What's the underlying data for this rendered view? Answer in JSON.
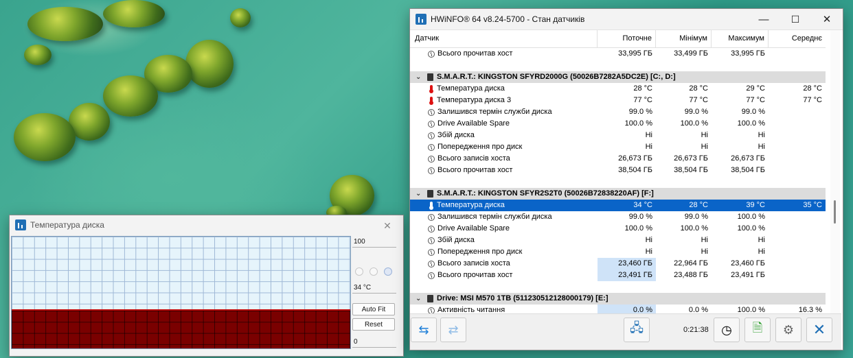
{
  "graph_window": {
    "title": "Температура диска",
    "max_value": "100",
    "current_value": "34 °C",
    "min_value": "0",
    "auto_fit_label": "Auto Fit",
    "reset_label": "Reset",
    "fill_level": 0.34,
    "close_icon": "close-icon"
  },
  "main_window": {
    "title": "HWiNFO® 64 v8.24-5700 - Стан датчиків",
    "columns": [
      "Датчик",
      "Поточне",
      "Мінімум",
      "Максимум",
      "Середнє"
    ],
    "rows": [
      {
        "type": "item",
        "icon": "clock-icon",
        "name": "Всього прочитав хост",
        "cur": "33,995 ГБ",
        "min": "33,499 ГБ",
        "max": "33,995 ГБ",
        "avg": ""
      },
      {
        "type": "spacer"
      },
      {
        "type": "group",
        "name": "S.M.A.R.T.: KINGSTON SFYRD2000G (50026B7282A5DC2E) [C:, D:]"
      },
      {
        "type": "item",
        "icon": "thermometer-icon",
        "name": "Температура диска",
        "cur": "28 °C",
        "min": "28 °C",
        "max": "29 °C",
        "avg": "28 °C"
      },
      {
        "type": "item",
        "icon": "thermometer-icon",
        "name": "Температура диска 3",
        "cur": "77 °C",
        "min": "77 °C",
        "max": "77 °C",
        "avg": "77 °C"
      },
      {
        "type": "item",
        "icon": "clock-icon",
        "name": "Залишився термін служби диска",
        "cur": "99.0 %",
        "min": "99.0 %",
        "max": "99.0 %",
        "avg": ""
      },
      {
        "type": "item",
        "icon": "clock-icon",
        "name": "Drive Available Spare",
        "cur": "100.0 %",
        "min": "100.0 %",
        "max": "100.0 %",
        "avg": ""
      },
      {
        "type": "item",
        "icon": "clock-icon",
        "name": "Збій диска",
        "cur": "Ні",
        "min": "Ні",
        "max": "Ні",
        "avg": ""
      },
      {
        "type": "item",
        "icon": "clock-icon",
        "name": "Попередження про диск",
        "cur": "Ні",
        "min": "Ні",
        "max": "Ні",
        "avg": ""
      },
      {
        "type": "item",
        "icon": "clock-icon",
        "name": "Всього записів хоста",
        "cur": "26,673 ГБ",
        "min": "26,673 ГБ",
        "max": "26,673 ГБ",
        "avg": ""
      },
      {
        "type": "item",
        "icon": "clock-icon",
        "name": "Всього прочитав хост",
        "cur": "38,504 ГБ",
        "min": "38,504 ГБ",
        "max": "38,504 ГБ",
        "avg": ""
      },
      {
        "type": "spacer"
      },
      {
        "type": "group",
        "name": "S.M.A.R.T.: KINGSTON SFYR2S2T0 (50026B72838220AF) [F:]"
      },
      {
        "type": "item",
        "icon": "thermometer-icon",
        "name": "Температура диска",
        "cur": "34 °C",
        "min": "28 °C",
        "max": "39 °C",
        "avg": "35 °C",
        "selected": true
      },
      {
        "type": "item",
        "icon": "clock-icon",
        "name": "Залишився термін служби диска",
        "cur": "99.0 %",
        "min": "99.0 %",
        "max": "100.0 %",
        "avg": ""
      },
      {
        "type": "item",
        "icon": "clock-icon",
        "name": "Drive Available Spare",
        "cur": "100.0 %",
        "min": "100.0 %",
        "max": "100.0 %",
        "avg": ""
      },
      {
        "type": "item",
        "icon": "clock-icon",
        "name": "Збій диска",
        "cur": "Ні",
        "min": "Ні",
        "max": "Ні",
        "avg": ""
      },
      {
        "type": "item",
        "icon": "clock-icon",
        "name": "Попередження про диск",
        "cur": "Ні",
        "min": "Ні",
        "max": "Ні",
        "avg": ""
      },
      {
        "type": "item",
        "icon": "clock-icon",
        "name": "Всього записів хоста",
        "cur": "23,460 ГБ",
        "min": "22,964 ГБ",
        "max": "23,460 ГБ",
        "avg": "",
        "highlight": true
      },
      {
        "type": "item",
        "icon": "clock-icon",
        "name": "Всього прочитав хост",
        "cur": "23,491 ГБ",
        "min": "23,488 ГБ",
        "max": "23,491 ГБ",
        "avg": "",
        "highlight": true
      },
      {
        "type": "spacer"
      },
      {
        "type": "group",
        "name": "Drive: MSI M570 1TB (511230512128000179) [E:]"
      },
      {
        "type": "item",
        "icon": "clock-icon",
        "name": "Активність читання",
        "cur": "0.0 %",
        "min": "0.0 %",
        "max": "100.0 %",
        "avg": "16.3 %",
        "highlight": true
      }
    ],
    "toolbar": {
      "timer": "0:21:38",
      "buttons": [
        "expand-collapse-icon",
        "collapse-icon",
        "network-icon",
        "clock-icon",
        "report-icon",
        "settings-icon",
        "close-icon"
      ]
    }
  },
  "colors": {
    "selection": "#0a64c8",
    "graph_fill": "#7a0000",
    "graph_bg": "#e6f4fb",
    "group_bg": "#dcdcdc",
    "highlight": "#cfe3f8"
  }
}
